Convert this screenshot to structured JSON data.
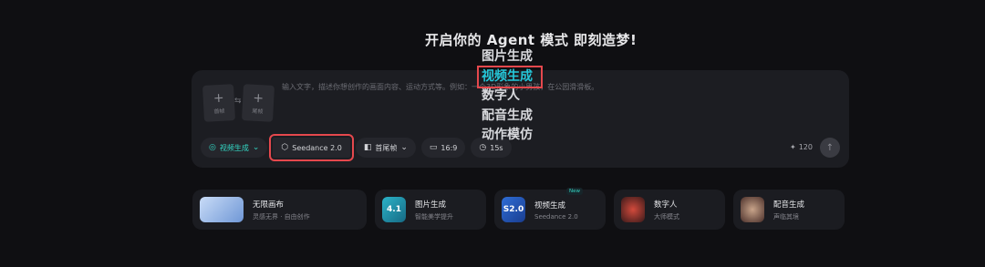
{
  "headline": "开启你的 Agent 模式 即刻造梦!",
  "composer": {
    "first_frame_label": "首帧",
    "last_frame_label": "尾帧",
    "prompt_placeholder": "输入文字，描述你想创作的画面内容、运动方式等。例如：一个3D形象的小男孩，在公园滑滑板。"
  },
  "toolbar": {
    "mode_label": "视频生成",
    "model_label": "Seedance 2.0",
    "frames_label": "首尾帧",
    "ratio_label": "16:9",
    "duration_label": "15s",
    "credits": "120"
  },
  "dropdown": {
    "items": [
      "图片生成",
      "视频生成",
      "数字人",
      "配音生成",
      "动作模仿"
    ],
    "selected": "视频生成"
  },
  "cards": [
    {
      "title": "无限画布",
      "subtitle": "灵感无界 · 自由创作"
    },
    {
      "title": "图片生成",
      "subtitle": "智能美学提升",
      "thumb": "4.1"
    },
    {
      "title": "视频生成",
      "subtitle": "Seedance 2.0",
      "thumb": "S2.0",
      "badge": "New"
    },
    {
      "title": "数字人",
      "subtitle": "大师模式"
    },
    {
      "title": "配音生成",
      "subtitle": "声临其境"
    }
  ],
  "colors": {
    "accent": "#33d6c3",
    "highlight": "#e5484d",
    "selected_item": "#25c7d9"
  }
}
